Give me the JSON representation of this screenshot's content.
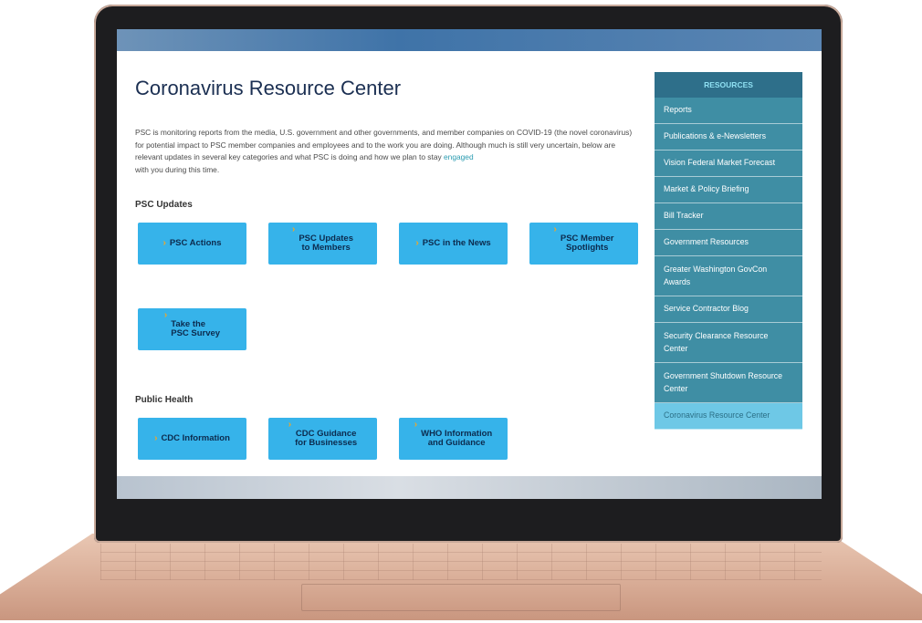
{
  "page": {
    "title": "Coronavirus Resource Center",
    "intro_text": "PSC is monitoring reports from the media, U.S. government and other governments, and member companies on COVID-19 (the novel coronavirus) for potential impact to PSC member companies and employees and to the work you are doing. Although much is still very uncertain, below are relevant updates in several key categories and what PSC is doing and how we plan to stay ",
    "intro_link": "engaged",
    "intro_tail": "with you during this time."
  },
  "psc_updates": {
    "heading": "PSC Updates",
    "tiles": [
      {
        "label": "PSC Actions"
      },
      {
        "label": "PSC Updates\nto Members"
      },
      {
        "label": "PSC in the News"
      },
      {
        "label": "PSC Member\nSpotlights"
      },
      {
        "label": "Take the\nPSC Survey"
      }
    ]
  },
  "public_health": {
    "heading": "Public Health",
    "tiles": [
      {
        "label": "CDC Information"
      },
      {
        "label": "CDC Guidance\nfor Businesses"
      },
      {
        "label": "WHO Information\nand Guidance"
      }
    ]
  },
  "sidebar": {
    "title": "RESOURCES",
    "items": [
      {
        "label": "Reports"
      },
      {
        "label": "Publications & e-Newsletters"
      },
      {
        "label": "Vision Federal Market Forecast"
      },
      {
        "label": "Market & Policy Briefing"
      },
      {
        "label": "Bill Tracker"
      },
      {
        "label": "Government Resources"
      },
      {
        "label": "Greater Washington GovCon Awards"
      },
      {
        "label": "Service Contractor Blog"
      },
      {
        "label": "Security Clearance Resource Center"
      },
      {
        "label": "Government Shutdown Resource Center"
      },
      {
        "label": "Coronavirus Resource Center"
      }
    ],
    "active_index": 10
  },
  "icons": {
    "tile_chevron": "chevron-right-icon"
  },
  "colors": {
    "tile_bg": "#36b3ea",
    "tile_text": "#0c2b4e",
    "chevron": "#f4a623",
    "sidebar_header": "#2e6f8a",
    "sidebar_item": "#3f8ea4",
    "sidebar_active": "#6ec8e6",
    "link": "#2a9bb0"
  }
}
